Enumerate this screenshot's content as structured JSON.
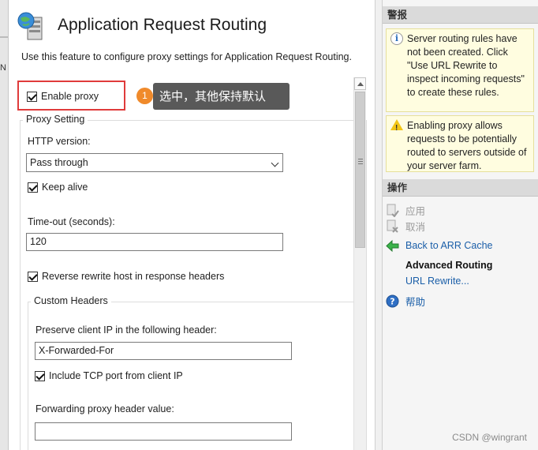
{
  "left_sliver": {
    "char": "N"
  },
  "main": {
    "title": "Application Request Routing",
    "description": "Use this feature to configure proxy settings for Application Request Routing.",
    "enable_proxy": {
      "label": "Enable proxy",
      "checked": true
    },
    "annotation": {
      "badge": "1",
      "tooltip": "选中，其他保持默认"
    },
    "proxy_setting": {
      "legend": "Proxy Setting",
      "http_version_label": "HTTP version:",
      "http_version_value": "Pass through",
      "keep_alive_label": "Keep alive",
      "timeout_label": "Time-out (seconds):",
      "timeout_value": "120",
      "reverse_rewrite_label": "Reverse rewrite host in response headers"
    },
    "custom_headers": {
      "legend": "Custom Headers",
      "preserve_ip_label": "Preserve client IP in the following header:",
      "preserve_ip_value": "X-Forwarded-For",
      "include_tcp_label": "Include TCP port from client IP",
      "forwarding_label": "Forwarding proxy header value:",
      "forwarding_value": ""
    }
  },
  "right": {
    "alerts_header": "警报",
    "alerts": [
      {
        "type": "info",
        "text": "Server routing rules have not been created. Click \"Use URL Rewrite to inspect incoming requests\" to create these rules."
      },
      {
        "type": "warning",
        "text": "Enabling proxy allows requests to be potentially routed to servers outside of your server farm."
      }
    ],
    "actions_header": "操作",
    "actions": {
      "apply": "应用",
      "cancel": "取消",
      "back": "Back to ARR Cache",
      "advanced": "Advanced Routing",
      "url_rewrite": "URL Rewrite...",
      "help": "帮助"
    }
  },
  "watermark": "CSDN @wingrant",
  "colors": {
    "highlight": "#e03b3b",
    "badge": "#f08a2b",
    "link": "#1a5ea8",
    "alert_bg": "#fffde0"
  }
}
